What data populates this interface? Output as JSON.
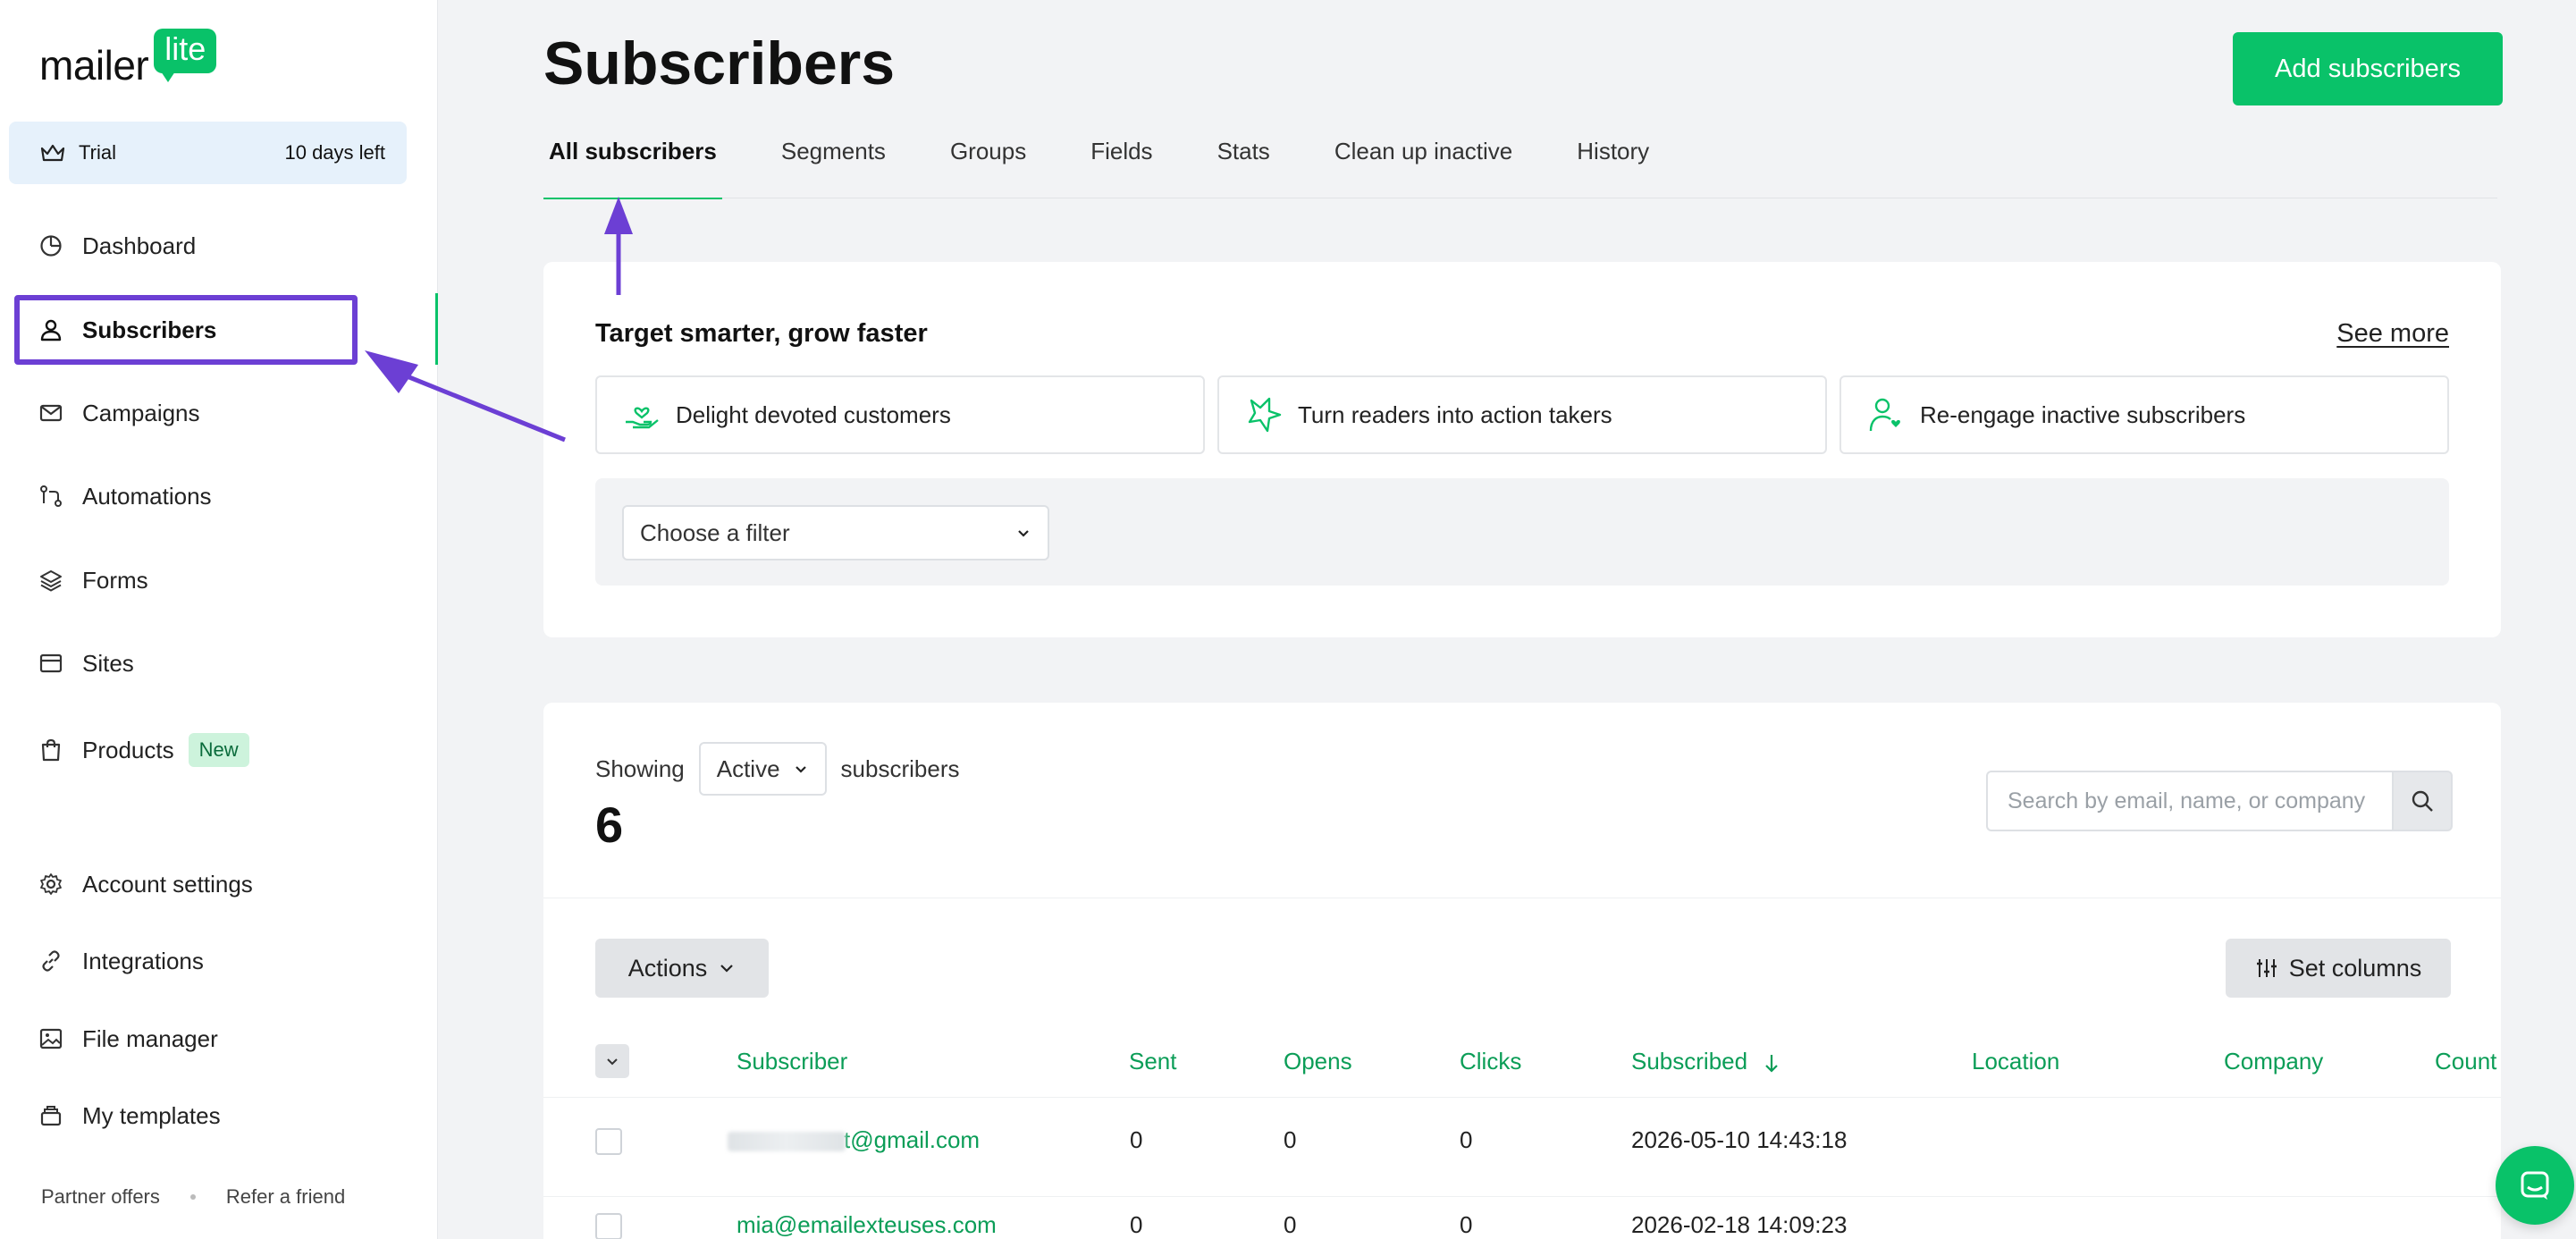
{
  "brand": {
    "name": "mailer",
    "badge": "lite"
  },
  "trial": {
    "label": "Trial",
    "days_left": "10 days left"
  },
  "sidebar": {
    "items": [
      {
        "label": "Dashboard",
        "icon": "dashboard-icon"
      },
      {
        "label": "Subscribers",
        "icon": "user-icon",
        "active": true
      },
      {
        "label": "Campaigns",
        "icon": "mail-icon"
      },
      {
        "label": "Automations",
        "icon": "automation-icon"
      },
      {
        "label": "Forms",
        "icon": "layers-icon"
      },
      {
        "label": "Sites",
        "icon": "browser-icon"
      },
      {
        "label": "Products",
        "icon": "bag-icon",
        "badge": "New"
      }
    ],
    "bottom_items": [
      {
        "label": "Account settings",
        "icon": "gear-icon"
      },
      {
        "label": "Integrations",
        "icon": "link-icon"
      },
      {
        "label": "File manager",
        "icon": "image-icon"
      },
      {
        "label": "My templates",
        "icon": "template-icon"
      }
    ],
    "footer": {
      "partner": "Partner offers",
      "refer": "Refer a friend"
    }
  },
  "header": {
    "title": "Subscribers",
    "add_button": "Add subscribers",
    "tabs": [
      "All subscribers",
      "Segments",
      "Groups",
      "Fields",
      "Stats",
      "Clean up inactive",
      "History"
    ],
    "active_tab": "All subscribers"
  },
  "target": {
    "title": "Target smarter, grow faster",
    "see_more": "See more",
    "suggestions": [
      "Delight devoted customers",
      "Turn readers into action takers",
      "Re-engage inactive subscribers"
    ],
    "filter_placeholder": "Choose a filter"
  },
  "list": {
    "showing_label": "Showing",
    "status": "Active",
    "suffix": "subscribers",
    "count": "6",
    "search_placeholder": "Search by email, name, or company",
    "actions_label": "Actions",
    "set_columns_label": "Set columns",
    "columns": [
      "Subscriber",
      "Sent",
      "Opens",
      "Clicks",
      "Subscribed",
      "Location",
      "Company",
      "Count"
    ],
    "rows": [
      {
        "email": "t@gmail.com",
        "sent": "0",
        "opens": "0",
        "clicks": "0",
        "subscribed": "2026-05-10 14:43:18"
      },
      {
        "email": "mia@emailexteuses.com",
        "sent": "0",
        "opens": "0",
        "clicks": "0",
        "subscribed": "2026-02-18 14:09:23"
      }
    ]
  },
  "colors": {
    "accent": "#09c269",
    "annotation": "#6c3fd4",
    "link_green": "#0b9d57"
  }
}
